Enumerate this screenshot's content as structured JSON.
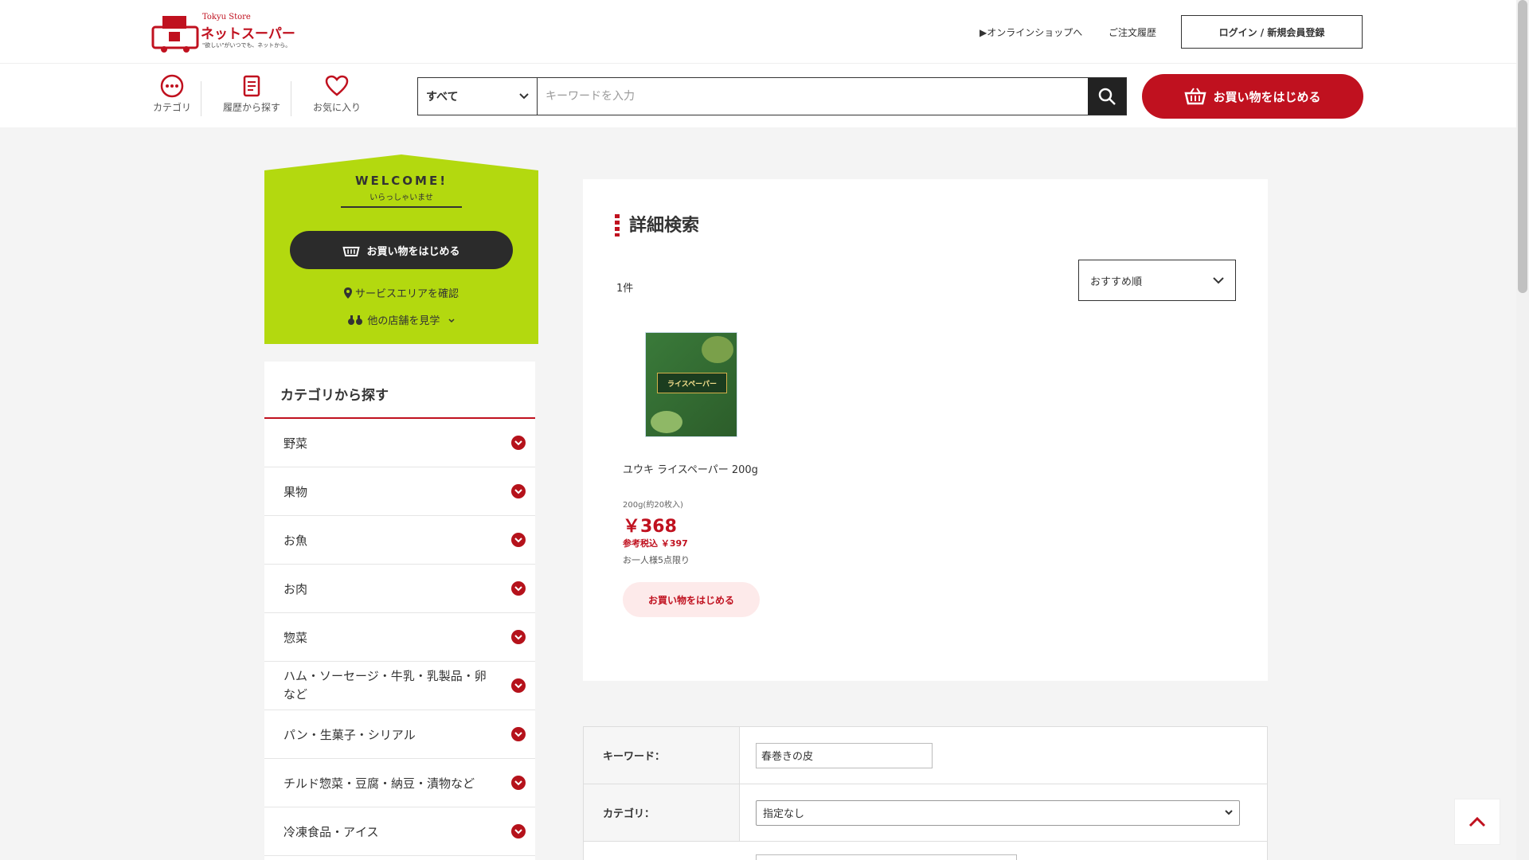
{
  "header": {
    "brand_top": "Tokyu Store",
    "brand_main": "ネットスーパー",
    "brand_tagline": "\"欲しい\"がいつでも、ネットから。",
    "links": [
      {
        "label": "▶オンラインショップへ"
      },
      {
        "label": "ご注文履歴"
      }
    ],
    "login_label": "ログイン / 新規会員登録"
  },
  "nav": {
    "category": "カテゴリ",
    "history": "履歴から探す",
    "favorites": "お気に入り"
  },
  "search": {
    "scope": "すべて",
    "placeholder": "キーワードを入力"
  },
  "start_button": "お買い物をはじめる",
  "welcome": {
    "title": "WELCOME!",
    "subtitle": "いらっしゃいませ",
    "button": "お買い物をはじめる",
    "area_link": "サービスエリアを確認",
    "store_link": "他の店舗を見学"
  },
  "categories": {
    "heading": "カテゴリから探す",
    "items": [
      {
        "label": "野菜"
      },
      {
        "label": "果物"
      },
      {
        "label": "お魚"
      },
      {
        "label": "お肉"
      },
      {
        "label": "惣菜"
      },
      {
        "label": "ハム・ソーセージ・牛乳・乳製品・卵など"
      },
      {
        "label": "パン・生菓子・シリアル"
      },
      {
        "label": "チルド惣菜・豆腐・納豆・漬物など"
      },
      {
        "label": "冷凍食品・アイス"
      }
    ]
  },
  "results": {
    "title": "詳細検索",
    "count": "1件",
    "sort": "おすすめ順",
    "product": {
      "name": "ユウキ ライスペーパー 200g",
      "quantity": "200g(約20枚入)",
      "price": "￥368",
      "tax_price": "参考税込 ￥397",
      "limit": "お一人様5点限り",
      "button": "お買い物をはじめる",
      "package_text": "ライスペーパー"
    }
  },
  "form": {
    "keyword_label": "キーワード：",
    "keyword_value": "春巻きの皮",
    "category_label": "カテゴリ：",
    "category_value": "指定なし"
  },
  "colors": {
    "accent": "#c0111f",
    "welcome_bg": "#b3d90f"
  }
}
